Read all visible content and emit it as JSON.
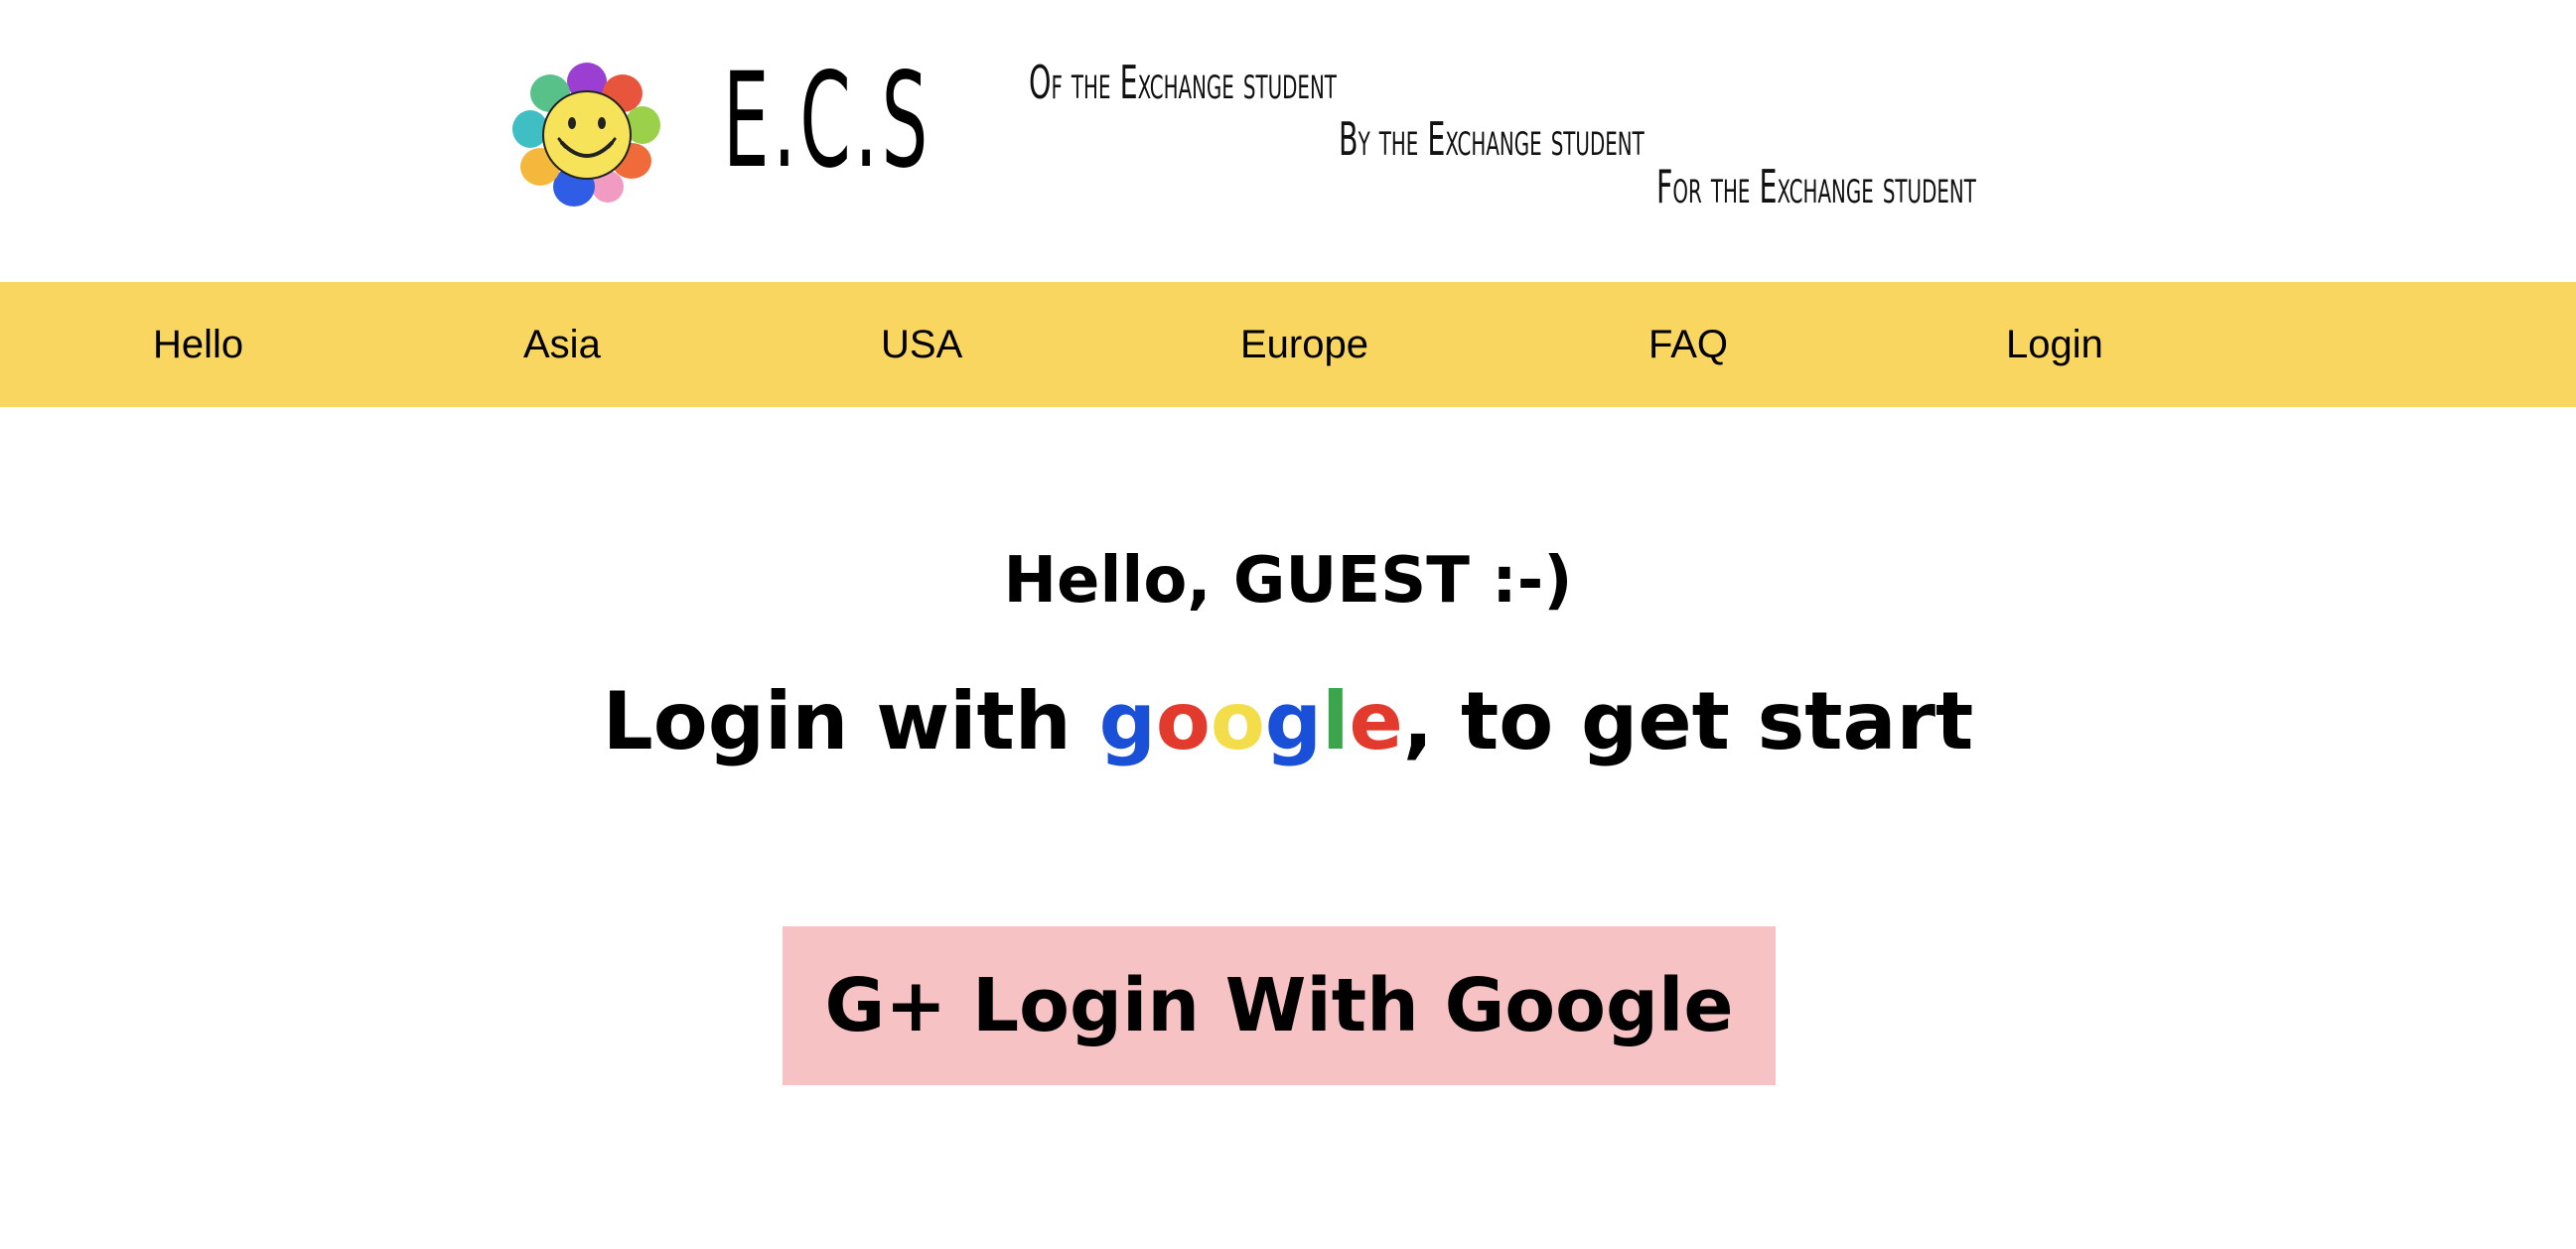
{
  "header": {
    "logo_icon": "smiley-flower-icon",
    "brand": "E.C.S",
    "taglines": [
      "Of the Exchange student",
      "By the Exchange student",
      "For the Exchange student"
    ]
  },
  "nav": {
    "items": [
      {
        "label": "Hello"
      },
      {
        "label": "Asia"
      },
      {
        "label": "USA"
      },
      {
        "label": "Europe"
      },
      {
        "label": "FAQ"
      },
      {
        "label": "Login"
      }
    ],
    "background": "#f8d65f"
  },
  "main": {
    "greeting": "Hello, GUEST :-)",
    "prompt_before": "Login with ",
    "google_letters": [
      "g",
      "o",
      "o",
      "g",
      "l",
      "e"
    ],
    "prompt_after": ", to get start",
    "login_button_label": "G+ Login With Google",
    "login_button_color": "#f6c2c3"
  },
  "colors": {
    "google_blue": "#1a4fd8",
    "google_red": "#e23a2c",
    "google_yellow": "#f4dd4a",
    "google_green": "#3aa54a"
  }
}
